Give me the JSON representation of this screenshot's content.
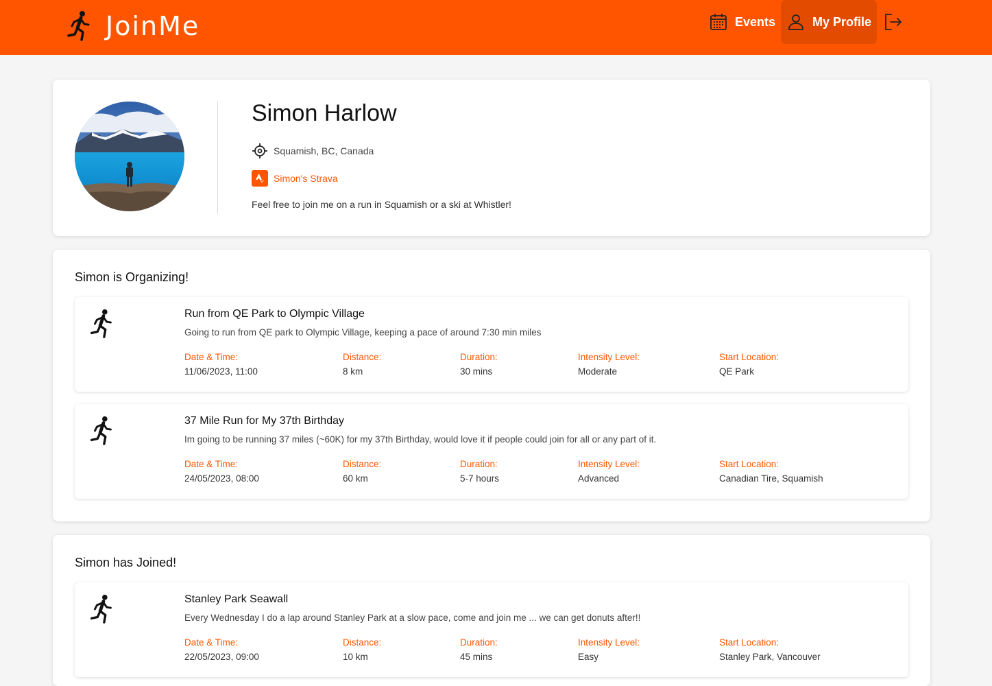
{
  "theme": {
    "accent": "#ff5500"
  },
  "header": {
    "brand": "JoinMe",
    "brand_icon": "runner-icon",
    "nav": {
      "events_label": "Events",
      "profile_label": "My Profile"
    },
    "icons": {
      "events": "calendar-icon",
      "profile": "user-icon",
      "logout": "logout-icon"
    }
  },
  "profile": {
    "name": "Simon Harlow",
    "location": "Squamish, BC, Canada",
    "strava_label": "Simon's Strava",
    "bio": "Feel free to join me on a run in Squamish or a ski at Whistler!"
  },
  "field_labels": {
    "date": "Date & Time:",
    "distance": "Distance:",
    "duration": "Duration:",
    "intensity": "Intensity Level:",
    "start": "Start Location:"
  },
  "organizing": {
    "title": "Simon is Organizing!",
    "events": [
      {
        "title": "Run from QE Park to Olympic Village",
        "description": "Going to run from QE park to Olympic Village, keeping a pace of around 7:30 min miles",
        "date": "11/06/2023, 11:00",
        "distance": "8 km",
        "duration": "30 mins",
        "intensity": "Moderate",
        "start": "QE Park"
      },
      {
        "title": "37 Mile Run for My 37th Birthday",
        "description": "Im going to be running 37 miles (~60K) for my 37th Birthday, would love it if people could join for all or any part of it.",
        "date": "24/05/2023, 08:00",
        "distance": "60 km",
        "duration": "5-7 hours",
        "intensity": "Advanced",
        "start": "Canadian Tire, Squamish"
      }
    ]
  },
  "joined": {
    "title": "Simon has Joined!",
    "events": [
      {
        "title": "Stanley Park Seawall",
        "description": "Every Wednesday I do a lap around Stanley Park at a slow pace, come and join me ... we can get donuts after!!",
        "date": "22/05/2023, 09:00",
        "distance": "10 km",
        "duration": "45 mins",
        "intensity": "Easy",
        "start": "Stanley Park, Vancouver"
      }
    ]
  }
}
